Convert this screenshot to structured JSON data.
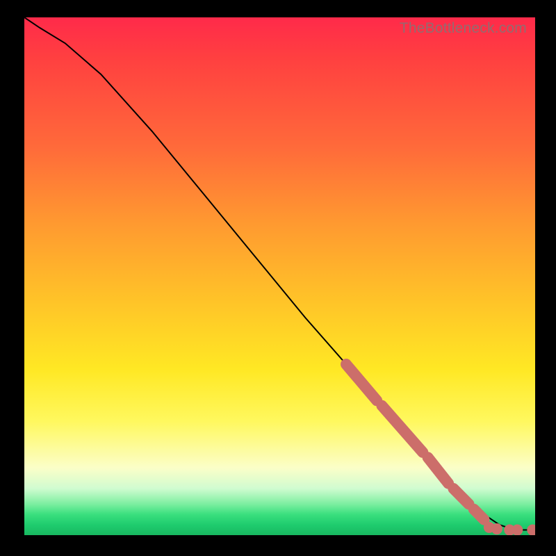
{
  "watermark": "TheBottleneck.com",
  "chart_data": {
    "type": "line",
    "title": "",
    "xlabel": "",
    "ylabel": "",
    "xlim": [
      0,
      100
    ],
    "ylim": [
      0,
      100
    ],
    "grid": false,
    "series": [
      {
        "name": "curve",
        "x": [
          0,
          3,
          8,
          15,
          25,
          35,
          45,
          55,
          63,
          70,
          78,
          85,
          90,
          93,
          96,
          100
        ],
        "y": [
          100,
          98,
          95,
          89,
          78,
          66,
          54,
          42,
          33,
          25,
          16,
          8,
          4,
          2,
          1,
          1
        ]
      }
    ],
    "highlight_segments": [
      {
        "x0": 63,
        "y0": 33,
        "x1": 69,
        "y1": 26
      },
      {
        "x0": 70,
        "y0": 25,
        "x1": 78,
        "y1": 16
      },
      {
        "x0": 79,
        "y0": 15,
        "x1": 83,
        "y1": 10
      },
      {
        "x0": 84,
        "y0": 9,
        "x1": 87,
        "y1": 6
      },
      {
        "x0": 88,
        "y0": 5,
        "x1": 90,
        "y1": 3
      }
    ],
    "highlight_points": [
      {
        "x": 91,
        "y": 1.5
      },
      {
        "x": 92.5,
        "y": 1.2
      },
      {
        "x": 95,
        "y": 1
      },
      {
        "x": 96.5,
        "y": 1
      },
      {
        "x": 99.5,
        "y": 1
      }
    ]
  }
}
